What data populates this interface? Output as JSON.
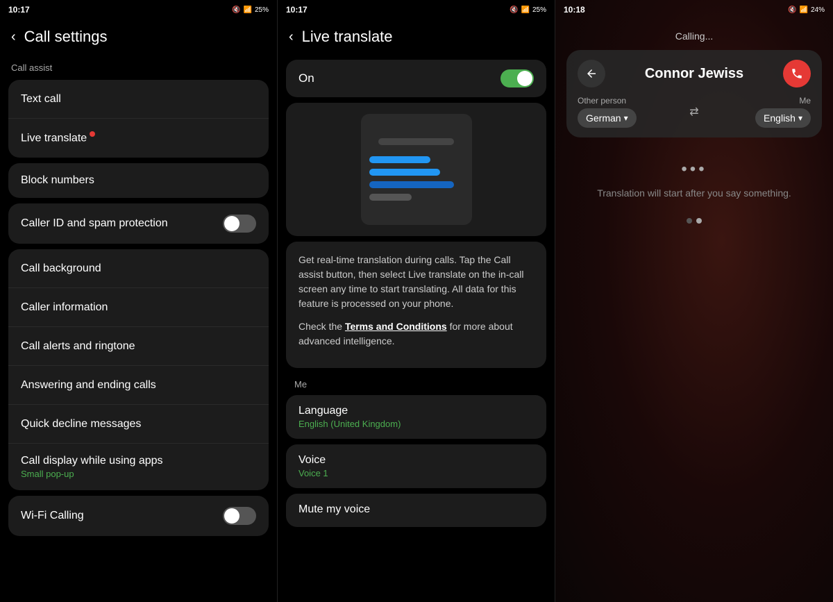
{
  "left": {
    "status": {
      "time": "10:17",
      "battery": "25%"
    },
    "title": "Call settings",
    "call_assist_label": "Call assist",
    "items_group1": [
      {
        "id": "text-call",
        "label": "Text call",
        "hasDot": false,
        "toggle": null
      },
      {
        "id": "live-translate",
        "label": "Live translate",
        "hasDot": true,
        "toggle": null
      }
    ],
    "block_numbers": "Block numbers",
    "caller_id": "Caller ID and spam protection",
    "caller_id_toggle": false,
    "items_group2": [
      {
        "id": "call-background",
        "label": "Call background"
      },
      {
        "id": "caller-information",
        "label": "Caller information"
      },
      {
        "id": "call-alerts",
        "label": "Call alerts and ringtone"
      },
      {
        "id": "answering-ending",
        "label": "Answering and ending calls"
      },
      {
        "id": "quick-decline",
        "label": "Quick decline messages"
      },
      {
        "id": "call-display",
        "label": "Call display while using apps",
        "subtext": "Small pop-up"
      }
    ],
    "wifi_calling": "Wi-Fi Calling",
    "wifi_toggle": false
  },
  "middle": {
    "status": {
      "time": "10:17",
      "battery": "25%"
    },
    "title": "Live translate",
    "on_label": "On",
    "toggle_on": true,
    "description1": "Get real-time translation during calls. Tap the Call assist button, then select Live translate on the in-call screen any time to start translating. All data for this feature is processed on your phone.",
    "description2": "Check the ",
    "terms_link": "Terms and Conditions",
    "description3": " for more about advanced intelligence.",
    "me_label": "Me",
    "language_label": "Language",
    "language_value": "English (United Kingdom)",
    "voice_label": "Voice",
    "voice_value": "Voice 1",
    "mute_label": "Mute my voice"
  },
  "right": {
    "status": {
      "time": "10:18",
      "battery": "24%"
    },
    "calling_text": "Calling...",
    "caller_name": "Connor Jewiss",
    "other_person_label": "Other person",
    "other_person_lang": "German",
    "me_label": "Me",
    "my_lang": "English",
    "dots": "•••",
    "translation_msg": "Translation will start after you say something.",
    "page_dots": [
      false,
      true
    ]
  }
}
